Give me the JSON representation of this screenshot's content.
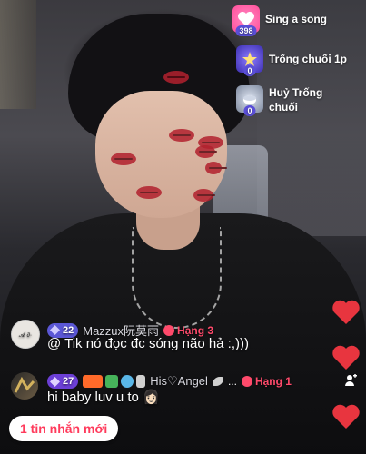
{
  "gifts": [
    {
      "label": "Sing a song",
      "count": "398",
      "icon": "heart-gift-icon",
      "color": "#ff5fa8"
    },
    {
      "label": "Trống chuối 1p",
      "count": "0",
      "icon": "star-drum-icon",
      "color": "#6b5ae6"
    },
    {
      "label": "Huỷ Trống chuối",
      "count": "0",
      "icon": "cancel-drum-icon",
      "color": "#9aa3b5"
    }
  ],
  "comments": [
    {
      "level": "22",
      "username": "Mazzux阮莫雨",
      "rank": "Hạng 3",
      "message": "@ Tik nó đọc đc sóng não hả :,)))"
    },
    {
      "level": "27",
      "username": "His♡Angel",
      "ellipsis": "...",
      "rank": "Hạng 1",
      "message": "hi baby luv u to 👩🏻"
    }
  ],
  "new_message_button": "1 tin nhắn mới",
  "colors": {
    "accent": "#ff3b5c",
    "level_badge": "#5b57d6",
    "heart": "#e8353f"
  }
}
